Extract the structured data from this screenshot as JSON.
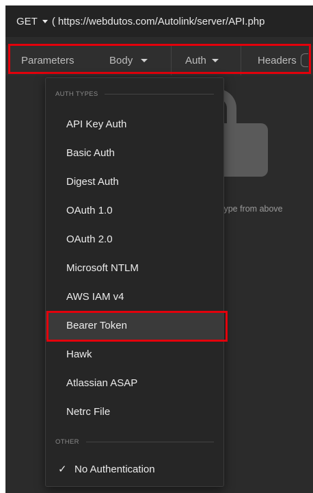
{
  "request": {
    "method": "GET",
    "url_prefix": "(",
    "url": "https://webdutos.com/Autolink/server/API.php"
  },
  "tabs": [
    {
      "label": "Parameters"
    },
    {
      "label": "Body"
    },
    {
      "label": "Auth"
    },
    {
      "label": "Headers"
    }
  ],
  "empty_state": {
    "hint": "type from above"
  },
  "auth_menu": {
    "section_auth_types": "AUTH TYPES",
    "items": [
      {
        "label": "API Key Auth"
      },
      {
        "label": "Basic Auth"
      },
      {
        "label": "Digest Auth"
      },
      {
        "label": "OAuth 1.0"
      },
      {
        "label": "OAuth 2.0"
      },
      {
        "label": "Microsoft NTLM"
      },
      {
        "label": "AWS IAM v4"
      },
      {
        "label": "Bearer Token"
      },
      {
        "label": "Hawk"
      },
      {
        "label": "Atlassian ASAP"
      },
      {
        "label": "Netrc File"
      }
    ],
    "section_other": "OTHER",
    "no_auth": {
      "check": "✓",
      "label": "No Authentication"
    },
    "hovered_item": "Bearer Token"
  },
  "colors": {
    "highlight": "#e3000b",
    "background": "#2b2b2b",
    "menu_background": "#262626"
  },
  "icons": [
    "dropdown-caret-icon",
    "lock-icon",
    "checkmark-icon"
  ]
}
